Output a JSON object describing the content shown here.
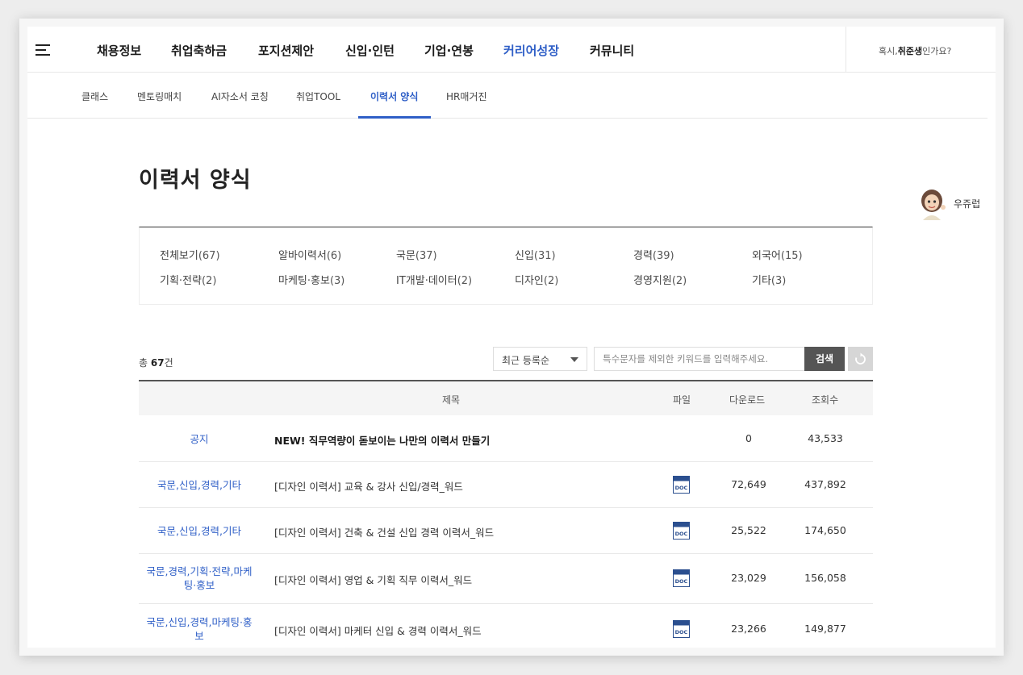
{
  "nav": {
    "menu": [
      {
        "label": "채용정보",
        "active": false
      },
      {
        "label": "취업축하금",
        "active": false
      },
      {
        "label": "포지션제안",
        "active": false
      },
      {
        "label": "신입·인턴",
        "active": false
      },
      {
        "label": "기업·연봉",
        "active": false
      },
      {
        "label": "커리어성장",
        "active": true
      },
      {
        "label": "커뮤니티",
        "active": false
      }
    ],
    "greeting_prefix": "혹시,",
    "greeting_bold": "취준생",
    "greeting_suffix": "인가요?"
  },
  "subnav": {
    "items": [
      {
        "label": "클래스",
        "active": false
      },
      {
        "label": "멘토링매치",
        "active": false
      },
      {
        "label": "AI자소서 코칭",
        "active": false
      },
      {
        "label": "취업TOOL",
        "active": false
      },
      {
        "label": "이력서 양식",
        "active": true
      },
      {
        "label": "HR매거진",
        "active": false
      }
    ]
  },
  "page": {
    "title": "이력서 양식"
  },
  "helper": {
    "label": "우쥬럽"
  },
  "categories": [
    {
      "name": "전체보기",
      "count": "(67)",
      "active": true
    },
    {
      "name": "알바이력서",
      "count": "(6)",
      "active": false
    },
    {
      "name": "국문",
      "count": "(37)",
      "active": false
    },
    {
      "name": "신입",
      "count": "(31)",
      "active": false
    },
    {
      "name": "경력",
      "count": "(39)",
      "active": false
    },
    {
      "name": "외국어",
      "count": "(15)",
      "active": false
    },
    {
      "name": "기획·전략",
      "count": "(2)",
      "active": false
    },
    {
      "name": "마케팅·홍보",
      "count": "(3)",
      "active": false
    },
    {
      "name": "IT개발·데이터",
      "count": "(2)",
      "active": false
    },
    {
      "name": "디자인",
      "count": "(2)",
      "active": false
    },
    {
      "name": "경영지원",
      "count": "(2)",
      "active": false
    },
    {
      "name": "기타",
      "count": "(3)",
      "active": false
    }
  ],
  "list": {
    "total_prefix": "총 ",
    "total_count": "67",
    "total_suffix": "건",
    "sort_selected": "최근 등록순",
    "search_placeholder": "특수문자를 제외한 키워드를 입력해주세요.",
    "search_button": "검색"
  },
  "table": {
    "headers": {
      "title": "제목",
      "file": "파일",
      "downloads": "다운로드",
      "views": "조회수"
    },
    "rows": [
      {
        "category": "공지",
        "title": "NEW! 직무역량이 돋보이는 나만의 이력서 만들기",
        "notice": true,
        "has_file": false,
        "downloads": "0",
        "views": "43,533"
      },
      {
        "category": "국문,신입,경력,기타",
        "title": "[디자인 이력서] 교육 & 강사 신입/경력_워드",
        "notice": false,
        "has_file": true,
        "file_label": "DOC",
        "downloads": "72,649",
        "views": "437,892"
      },
      {
        "category": "국문,신입,경력,기타",
        "title": "[디자인 이력서] 건축 & 건설 신입 경력 이력서_워드",
        "notice": false,
        "has_file": true,
        "file_label": "DOC",
        "downloads": "25,522",
        "views": "174,650"
      },
      {
        "category": "국문,경력,기획·전략,마케팅·홍보",
        "title": "[디자인 이력서] 영업 & 기획 직무 이력서_워드",
        "notice": false,
        "has_file": true,
        "file_label": "DOC",
        "downloads": "23,029",
        "views": "156,058"
      },
      {
        "category": "국문,신입,경력,마케팅·홍보",
        "title": "[디자인 이력서] 마케터 신입 & 경력 이력서_워드",
        "notice": false,
        "has_file": true,
        "file_label": "DOC",
        "downloads": "23,266",
        "views": "149,877"
      }
    ]
  },
  "colors": {
    "accent": "#2f5fc7",
    "search_button": "#555555",
    "reset_button": "#d6d6d6"
  }
}
